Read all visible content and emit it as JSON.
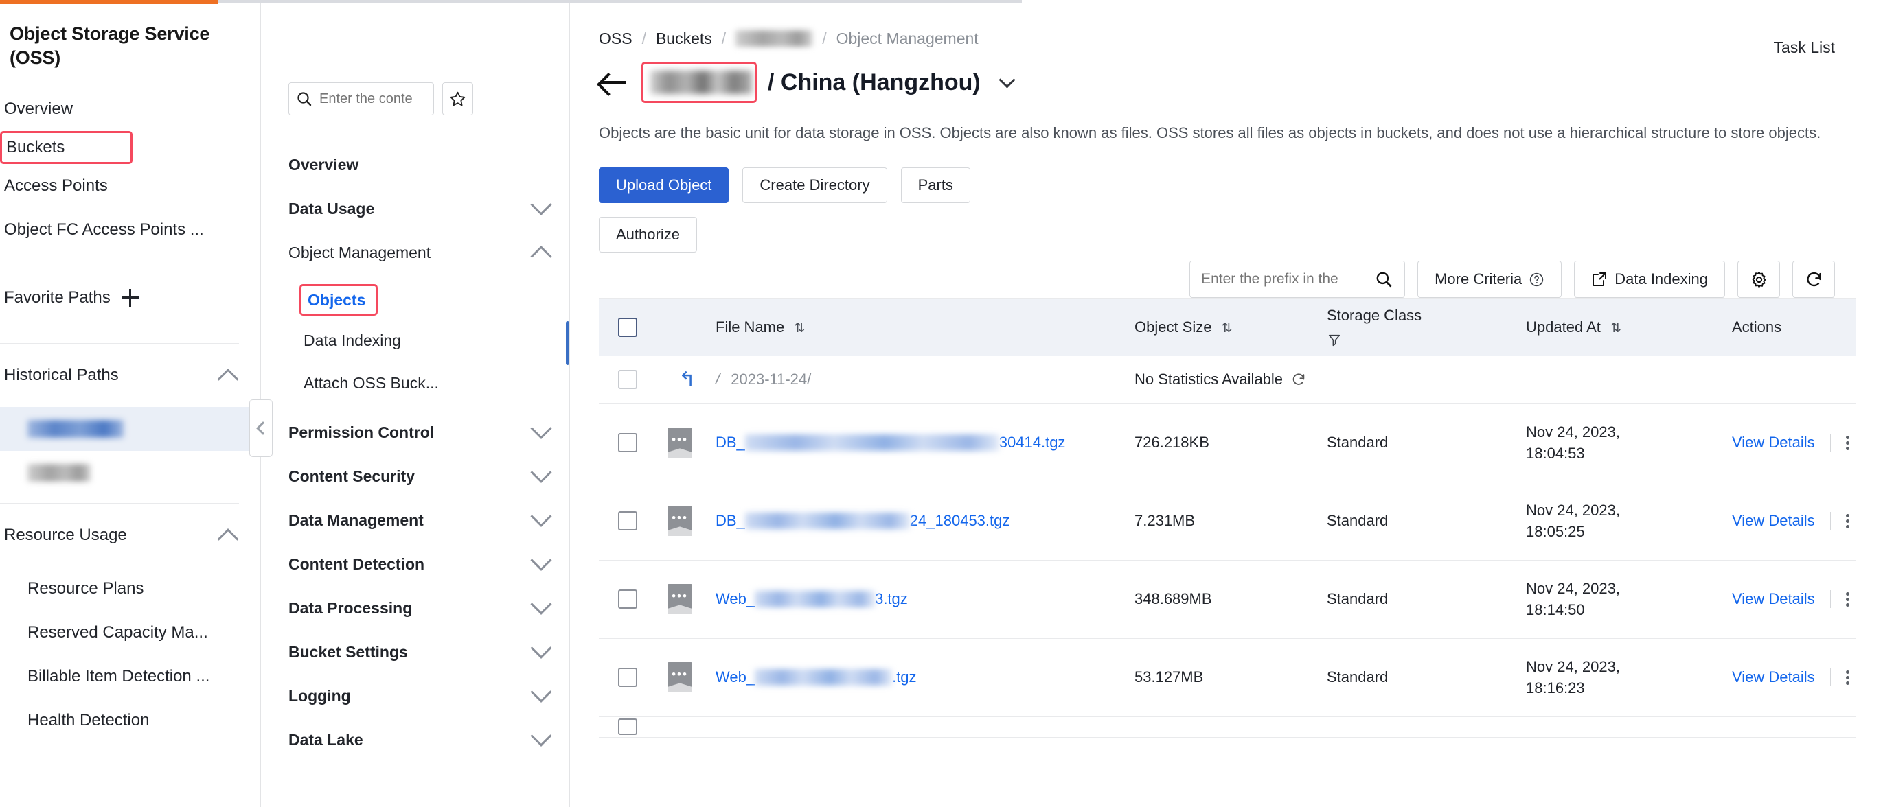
{
  "product_nav": {
    "title": "Object Storage Service (OSS)",
    "items": [
      {
        "label": "Overview"
      },
      {
        "label": "Buckets"
      },
      {
        "label": "Access Points"
      },
      {
        "label": "Object FC Access Points ..."
      }
    ],
    "favorite_paths": {
      "label": "Favorite Paths",
      "add_icon": "plus-icon"
    },
    "historical_paths": {
      "label": "Historical Paths",
      "chevron": "chevron-up-icon",
      "items": [
        "",
        ""
      ]
    },
    "resource_usage": {
      "label": "Resource Usage",
      "chevron": "chevron-up-icon",
      "items": [
        {
          "label": "Resource Plans"
        },
        {
          "label": "Reserved Capacity Ma..."
        },
        {
          "label": "Billable Item Detection ..."
        },
        {
          "label": "Health Detection"
        }
      ]
    }
  },
  "bucket_nav": {
    "search_placeholder": "Enter the conte",
    "search_value": "",
    "search_icon": "search-icon",
    "favorite_icon": "star-icon",
    "collapse_icon": "chevron-left-icon",
    "items": [
      {
        "label": "Overview",
        "bold": true,
        "chevron": ""
      },
      {
        "label": "Data Usage",
        "bold": true,
        "chevron": "chevron-down-icon"
      },
      {
        "label": "Object Management",
        "bold": false,
        "chevron": "chevron-up-icon"
      },
      {
        "label": "Permission Control",
        "bold": true,
        "chevron": "chevron-down-icon"
      },
      {
        "label": "Content Security",
        "bold": true,
        "chevron": "chevron-down-icon"
      },
      {
        "label": "Data Management",
        "bold": true,
        "chevron": "chevron-down-icon"
      },
      {
        "label": "Content Detection",
        "bold": true,
        "chevron": "chevron-down-icon"
      },
      {
        "label": "Data Processing",
        "bold": true,
        "chevron": "chevron-down-icon"
      },
      {
        "label": "Bucket Settings",
        "bold": true,
        "chevron": "chevron-down-icon"
      },
      {
        "label": "Logging",
        "bold": true,
        "chevron": "chevron-down-icon"
      },
      {
        "label": "Data Lake",
        "bold": true,
        "chevron": "chevron-down-icon"
      }
    ],
    "object_management_children": [
      {
        "label": "Objects",
        "selected": true
      },
      {
        "label": "Data Indexing",
        "selected": false
      },
      {
        "label": "Attach OSS Buck...",
        "selected": false
      }
    ]
  },
  "header": {
    "breadcrumb": [
      {
        "label": "OSS",
        "muted": false
      },
      {
        "label": "Buckets",
        "muted": false
      },
      {
        "label": "",
        "muted": false,
        "blurred": true
      },
      {
        "label": "Object Management",
        "muted": true
      }
    ],
    "task_list": "Task List",
    "back_icon": "back-arrow-icon",
    "bucket_name": "",
    "region": "/ China (Hangzhou)",
    "region_chevron": "chevron-down-icon",
    "description": "Objects are the basic unit for data storage in OSS. Objects are also known as files. OSS stores all files as objects in buckets, and does not use a hierarchical structure to store objects."
  },
  "toolbar": {
    "upload_object": "Upload Object",
    "create_directory": "Create Directory",
    "parts": "Parts",
    "authorize": "Authorize",
    "prefix_placeholder": "Enter the prefix in the",
    "prefix_value": "",
    "search_icon": "search-icon",
    "more_criteria": "More Criteria",
    "help_icon": "question-circle-icon",
    "data_indexing": "Data Indexing",
    "external_link_icon": "external-link-icon",
    "settings_icon": "gear-icon",
    "refresh_icon": "refresh-icon"
  },
  "table": {
    "columns": [
      {
        "label": "File Name",
        "sortable": true
      },
      {
        "label": "Object Size",
        "sortable": true
      },
      {
        "label": "Storage Class",
        "filterable": true
      },
      {
        "label": "Updated At",
        "sortable": true
      },
      {
        "label": "Actions",
        "sortable": false
      }
    ],
    "parent_row": {
      "path": "2023-11-24/",
      "slash": "/",
      "back_icon": "return-arrow-icon",
      "size_text": "No Statistics Available",
      "refresh_icon": "refresh-icon"
    },
    "rows": [
      {
        "name_prefix": "DB_",
        "name_suffix": "30414.tgz",
        "blur_width": 370,
        "size": "726.218KB",
        "storage_class": "Standard",
        "updated_line1": "Nov 24, 2023,",
        "updated_line2": "18:04:53",
        "action": "View Details",
        "menu_icon": "kebab-menu-icon"
      },
      {
        "name_prefix": "DB_",
        "name_suffix": "24_180453.tgz",
        "blur_width": 240,
        "size": "7.231MB",
        "storage_class": "Standard",
        "updated_line1": "Nov 24, 2023,",
        "updated_line2": "18:05:25",
        "action": "View Details",
        "menu_icon": "kebab-menu-icon"
      },
      {
        "name_prefix": "Web_",
        "name_suffix": "3.tgz",
        "blur_width": 175,
        "size": "348.689MB",
        "storage_class": "Standard",
        "updated_line1": "Nov 24, 2023,",
        "updated_line2": "18:14:50",
        "action": "View Details",
        "menu_icon": "kebab-menu-icon"
      },
      {
        "name_prefix": "Web_",
        "name_suffix": ".tgz",
        "blur_width": 200,
        "size": "53.127MB",
        "storage_class": "Standard",
        "updated_line1": "Nov 24, 2023,",
        "updated_line2": "18:16:23",
        "action": "View Details",
        "menu_icon": "kebab-menu-icon"
      }
    ]
  },
  "colors": {
    "accent_orange": "#EE7023",
    "primary_blue": "#2B61D1",
    "link_blue": "#1366EC",
    "highlight_red": "#F5495E",
    "header_bg": "#EFF2F7"
  }
}
